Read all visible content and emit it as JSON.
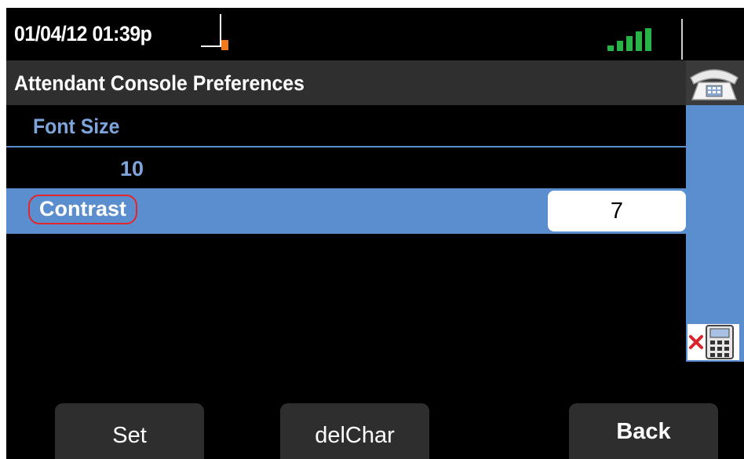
{
  "status_bar": {
    "datetime": "01/04/12 01:39p",
    "line_indicator_color": "#f07a1c",
    "signal_color": "#27b54a"
  },
  "title_bar": {
    "title": "Attendant Console Preferences"
  },
  "list": {
    "font_size_label": "Font Size",
    "font_size_value": "10",
    "contrast_label": "Contrast",
    "contrast_value": "7"
  },
  "colors": {
    "accent": "#5b8ecf",
    "highlight_outline": "#e2262a"
  },
  "side_panel": {
    "top_icon": "phone-icon",
    "bottom_icon": "keypad-icon"
  },
  "softkeys": {
    "set": "Set",
    "delchar": "delChar",
    "back": "Back"
  }
}
